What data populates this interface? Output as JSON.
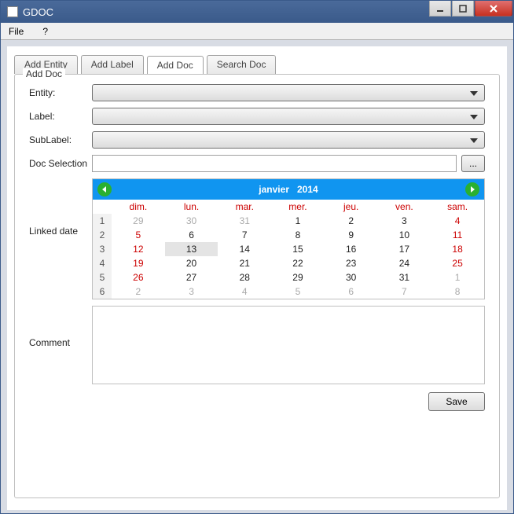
{
  "window": {
    "title": "GDOC"
  },
  "menubar": {
    "file": "File",
    "help": "?"
  },
  "tabs": [
    {
      "label": "Add Entity",
      "active": false
    },
    {
      "label": "Add Label",
      "active": false
    },
    {
      "label": "Add Doc",
      "active": true
    },
    {
      "label": "Search Doc",
      "active": false
    }
  ],
  "group": {
    "title": "Add Doc"
  },
  "form": {
    "entity_label": "Entity:",
    "label_label": "Label:",
    "sublabel_label": "SubLabel:",
    "docsel_label": "Doc Selection",
    "browse_label": "...",
    "linked_label": "Linked date",
    "comment_label": "Comment",
    "save_label": "Save"
  },
  "calendar": {
    "month": "janvier",
    "year": "2014",
    "day_headers": [
      "dim.",
      "lun.",
      "mar.",
      "mer.",
      "jeu.",
      "ven.",
      "sam."
    ],
    "weeks": [
      {
        "wk": "1",
        "days": [
          {
            "n": "29",
            "t": "other"
          },
          {
            "n": "30",
            "t": "other"
          },
          {
            "n": "31",
            "t": "other"
          },
          {
            "n": "1",
            "t": "cur"
          },
          {
            "n": "2",
            "t": "cur"
          },
          {
            "n": "3",
            "t": "cur"
          },
          {
            "n": "4",
            "t": "wknd"
          }
        ]
      },
      {
        "wk": "2",
        "days": [
          {
            "n": "5",
            "t": "wknd"
          },
          {
            "n": "6",
            "t": "cur"
          },
          {
            "n": "7",
            "t": "cur"
          },
          {
            "n": "8",
            "t": "cur"
          },
          {
            "n": "9",
            "t": "cur"
          },
          {
            "n": "10",
            "t": "cur"
          },
          {
            "n": "11",
            "t": "wknd"
          }
        ]
      },
      {
        "wk": "3",
        "days": [
          {
            "n": "12",
            "t": "wknd"
          },
          {
            "n": "13",
            "t": "sel"
          },
          {
            "n": "14",
            "t": "cur"
          },
          {
            "n": "15",
            "t": "cur"
          },
          {
            "n": "16",
            "t": "cur"
          },
          {
            "n": "17",
            "t": "cur"
          },
          {
            "n": "18",
            "t": "wknd"
          }
        ]
      },
      {
        "wk": "4",
        "days": [
          {
            "n": "19",
            "t": "wknd"
          },
          {
            "n": "20",
            "t": "cur"
          },
          {
            "n": "21",
            "t": "cur"
          },
          {
            "n": "22",
            "t": "cur"
          },
          {
            "n": "23",
            "t": "cur"
          },
          {
            "n": "24",
            "t": "cur"
          },
          {
            "n": "25",
            "t": "wknd"
          }
        ]
      },
      {
        "wk": "5",
        "days": [
          {
            "n": "26",
            "t": "wknd"
          },
          {
            "n": "27",
            "t": "cur"
          },
          {
            "n": "28",
            "t": "cur"
          },
          {
            "n": "29",
            "t": "cur"
          },
          {
            "n": "30",
            "t": "cur"
          },
          {
            "n": "31",
            "t": "cur"
          },
          {
            "n": "1",
            "t": "other"
          }
        ]
      },
      {
        "wk": "6",
        "days": [
          {
            "n": "2",
            "t": "other"
          },
          {
            "n": "3",
            "t": "other"
          },
          {
            "n": "4",
            "t": "other"
          },
          {
            "n": "5",
            "t": "other"
          },
          {
            "n": "6",
            "t": "other"
          },
          {
            "n": "7",
            "t": "other"
          },
          {
            "n": "8",
            "t": "other"
          }
        ]
      }
    ]
  }
}
